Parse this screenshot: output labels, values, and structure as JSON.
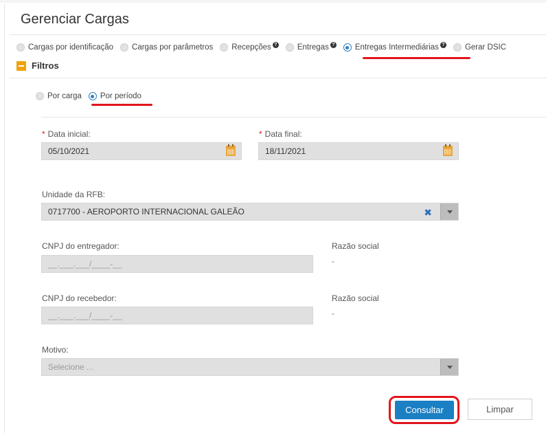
{
  "page": {
    "title": "Gerenciar Cargas"
  },
  "tabs": [
    {
      "label": "Cargas por identificação",
      "selected": false,
      "help": false
    },
    {
      "label": "Cargas por parâmetros",
      "selected": false,
      "help": false
    },
    {
      "label": "Recepções",
      "selected": false,
      "help": true
    },
    {
      "label": "Entregas",
      "selected": false,
      "help": true
    },
    {
      "label": "Entregas Intermediárias",
      "selected": true,
      "help": true
    },
    {
      "label": "Gerar DSIC",
      "selected": false,
      "help": false
    }
  ],
  "filters": {
    "label": "Filtros",
    "mode_options": [
      {
        "label": "Por carga",
        "selected": false
      },
      {
        "label": "Por período",
        "selected": true
      }
    ]
  },
  "form": {
    "data_inicial": {
      "label": "Data inicial:",
      "value": "05/10/2021",
      "required": true
    },
    "data_final": {
      "label": "Data final:",
      "value": "18/11/2021",
      "required": true
    },
    "unidade": {
      "label": "Unidade da RFB:",
      "value": "0717700 - AEROPORTO INTERNACIONAL GALEÃO",
      "clear": "✖"
    },
    "cnpj_entregador": {
      "label": "CNPJ do entregador:",
      "mask": "__.___.___/____-__"
    },
    "razao_entregador": {
      "label": "Razão social",
      "value": "-"
    },
    "cnpj_recebedor": {
      "label": "CNPJ do recebedor:",
      "mask": "__.___.___/____-__"
    },
    "razao_recebedor": {
      "label": "Razão social",
      "value": "-"
    },
    "motivo": {
      "label": "Motivo:",
      "placeholder": "Selecione ..."
    }
  },
  "actions": {
    "consultar": "Consultar",
    "limpar": "Limpar"
  },
  "colors": {
    "accent": "#1b7fc4",
    "highlight": "#e3141b",
    "collapse": "#f0a30a"
  },
  "icons": [
    "help-icon",
    "calendar-icon",
    "clear-icon",
    "chevron-down-icon",
    "minus-icon"
  ]
}
